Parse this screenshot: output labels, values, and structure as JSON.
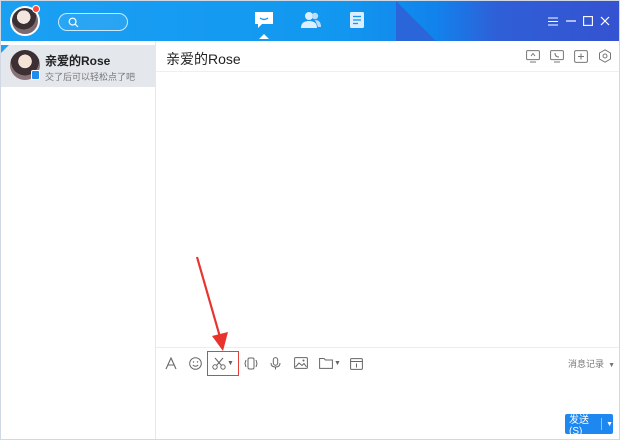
{
  "colors": {
    "titlebar": "#1297f0",
    "accent": "#1e88f0",
    "highlight": "#e2403a",
    "notification_dot": "#ff4a3c"
  },
  "titlebar": {
    "tabs": [
      {
        "icon": "message-icon",
        "active": true
      },
      {
        "icon": "contacts-icon",
        "active": false
      },
      {
        "icon": "document-icon",
        "active": false
      }
    ],
    "window_controls": [
      "menu-icon",
      "minimize-icon",
      "maximize-icon",
      "close-icon"
    ]
  },
  "sidebar": {
    "contacts": [
      {
        "name": "亲爱的Rose",
        "preview": "交了后可以轻松点了吧",
        "selected": true
      }
    ]
  },
  "chat": {
    "title": "亲爱的Rose",
    "header_icons": [
      "screen-share-icon",
      "phone-icon",
      "add-member-icon",
      "settings-icon"
    ],
    "toolbar": {
      "tools": [
        "font-icon",
        "emoji-icon",
        "scissors-icon",
        "shake-icon",
        "microphone-icon",
        "image-icon",
        "folder-icon",
        "calendar-icon"
      ],
      "history_label": "消息记录"
    },
    "send_label": "发送(S)"
  }
}
